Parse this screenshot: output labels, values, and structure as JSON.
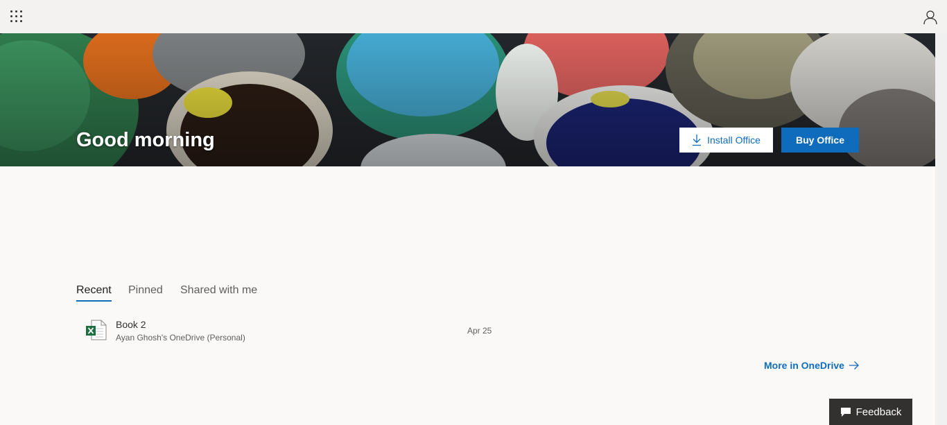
{
  "header": {
    "app_launcher_icon": "waffle-grid-icon",
    "account_icon": "person-icon"
  },
  "hero": {
    "greeting": "Good morning",
    "install_label": "Install Office",
    "install_icon": "download-icon",
    "buy_label": "Buy Office"
  },
  "tabs": [
    {
      "label": "Recent",
      "active": true
    },
    {
      "label": "Pinned",
      "active": false
    },
    {
      "label": "Shared with me",
      "active": false
    }
  ],
  "files": [
    {
      "name": "Book 2",
      "location": "Ayan Ghosh's OneDrive (Personal)",
      "date": "Apr 25",
      "icon": "excel-file-icon"
    }
  ],
  "more_link": {
    "label": "More in OneDrive",
    "icon": "arrow-right-icon"
  },
  "feedback": {
    "label": "Feedback",
    "icon": "chat-icon"
  },
  "colors": {
    "accent": "#0f6cbd",
    "excel_green": "#1d6f42",
    "page_bg": "#faf9f8",
    "topbar_bg": "#f3f2f1"
  }
}
